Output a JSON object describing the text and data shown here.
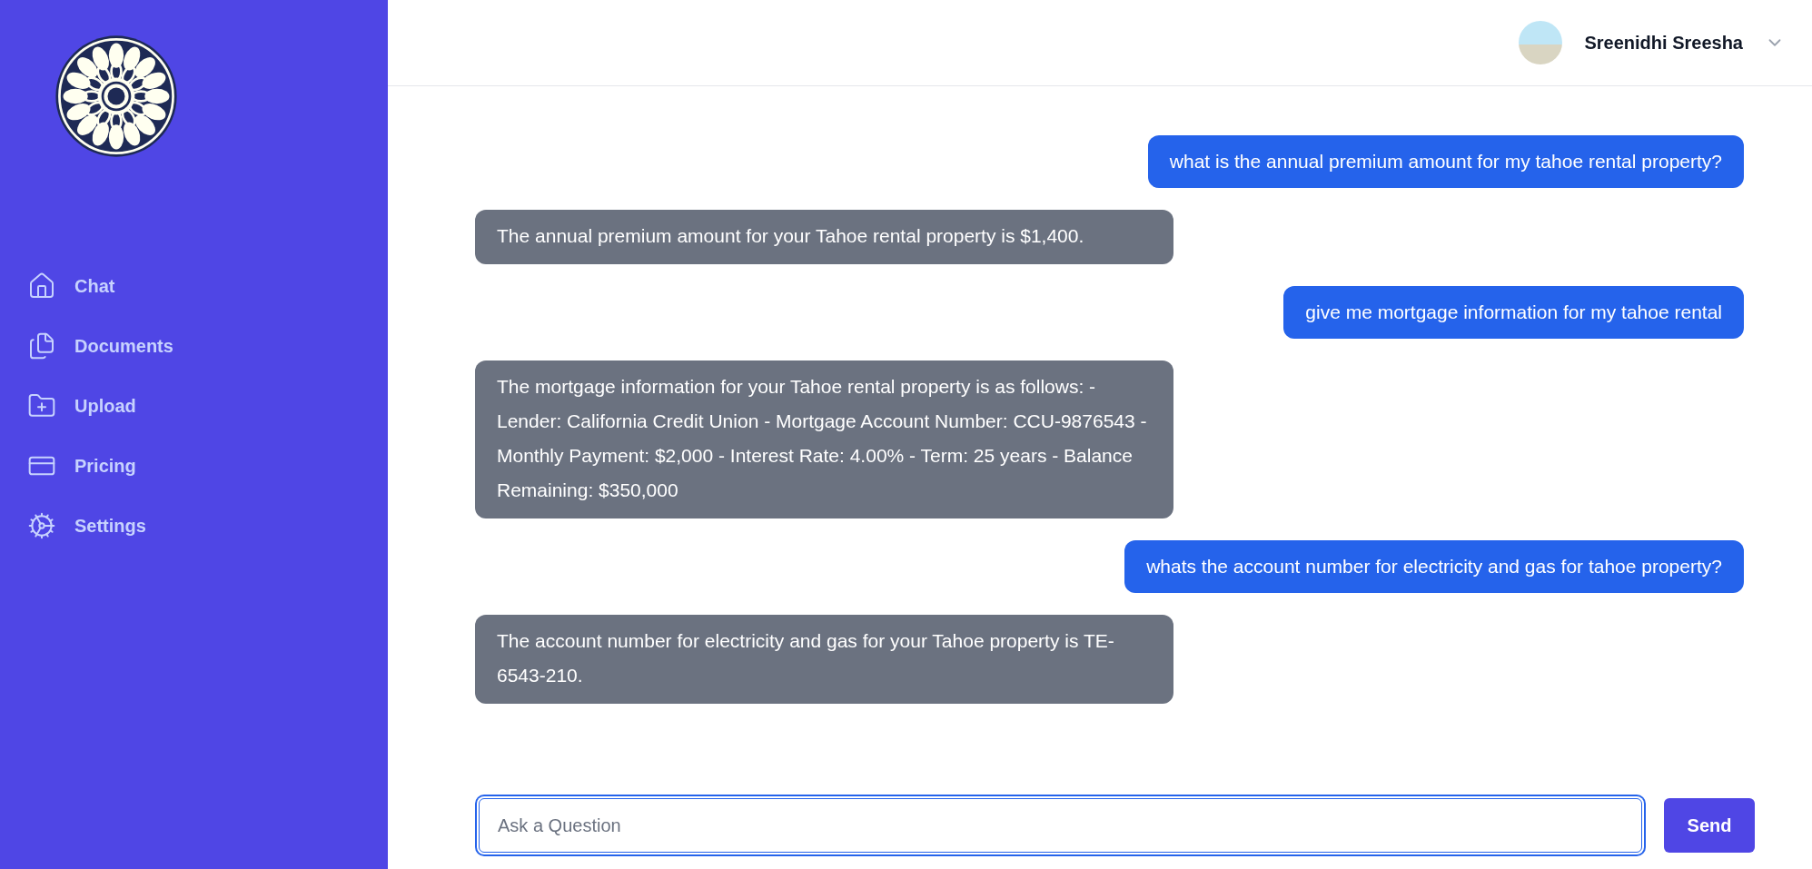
{
  "sidebar": {
    "items": [
      {
        "label": "Chat"
      },
      {
        "label": "Documents"
      },
      {
        "label": "Upload"
      },
      {
        "label": "Pricing"
      },
      {
        "label": "Settings"
      }
    ]
  },
  "header": {
    "user_name": "Sreenidhi Sreesha"
  },
  "messages": [
    {
      "kind": "user",
      "text": "what is the annual premium amount for my tahoe rental property?"
    },
    {
      "kind": "assistant",
      "text": "The annual premium amount for your Tahoe rental property is $1,400."
    },
    {
      "kind": "user",
      "text": "give me mortgage information for my tahoe rental"
    },
    {
      "kind": "assistant",
      "text": "The mortgage information for your Tahoe rental property is as follows: - Lender: California Credit Union - Mortgage Account Number: CCU-9876543 - Monthly Payment: $2,000 - Interest Rate: 4.00% - Term: 25 years - Balance Remaining: $350,000"
    },
    {
      "kind": "user",
      "text": "whats the account number for electricity and gas for tahoe property?"
    },
    {
      "kind": "assistant",
      "text": "The account number for electricity and gas for your Tahoe property is TE-6543-210."
    }
  ],
  "composer": {
    "placeholder": "Ask a Question",
    "button": "Send"
  }
}
